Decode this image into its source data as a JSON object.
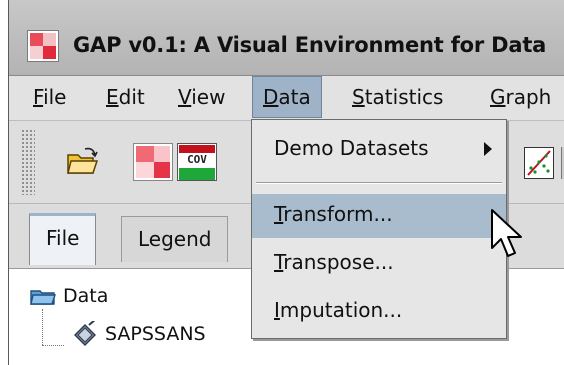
{
  "window": {
    "title": "GAP v0.1: A Visual Environment for Data"
  },
  "menubar": {
    "file": {
      "mnemonic": "F",
      "rest": "ile"
    },
    "edit": {
      "mnemonic": "E",
      "rest": "dit"
    },
    "view": {
      "mnemonic": "V",
      "rest": "iew"
    },
    "data": {
      "mnemonic": "D",
      "rest": "ata"
    },
    "statistics": {
      "mnemonic": "S",
      "rest": "tatistics"
    },
    "graph": {
      "mnemonic": "G",
      "rest": "raph"
    }
  },
  "toolbar": {
    "cov_label": "COV",
    "buttons": [
      "open-folder-icon",
      "heatmap-icon",
      "covariance-icon",
      "scatter-icon"
    ]
  },
  "tabs": [
    {
      "label": "File",
      "selected": true
    },
    {
      "label": "Legend",
      "selected": false
    }
  ],
  "tree": {
    "root": {
      "label": "Data",
      "icon": "data-folder-icon"
    },
    "child": {
      "label": "SAPSSANS",
      "icon": "dataset-icon"
    }
  },
  "data_menu": {
    "items": [
      {
        "pre": "Demo Datasets",
        "mnemonic": "",
        "rest": "",
        "has_submenu": true
      },
      {
        "pre": "",
        "mnemonic": "T",
        "rest": "ransform...",
        "highlighted": true
      },
      {
        "pre": "",
        "mnemonic": "T",
        "rest": "ranspose..."
      },
      {
        "pre": "",
        "mnemonic": "I",
        "rest": "mputation..."
      }
    ]
  },
  "colors": {
    "menu_highlight": "#a9bccd",
    "active_menu": "#9fb3c8",
    "window_bg": "#dcdcdc"
  }
}
